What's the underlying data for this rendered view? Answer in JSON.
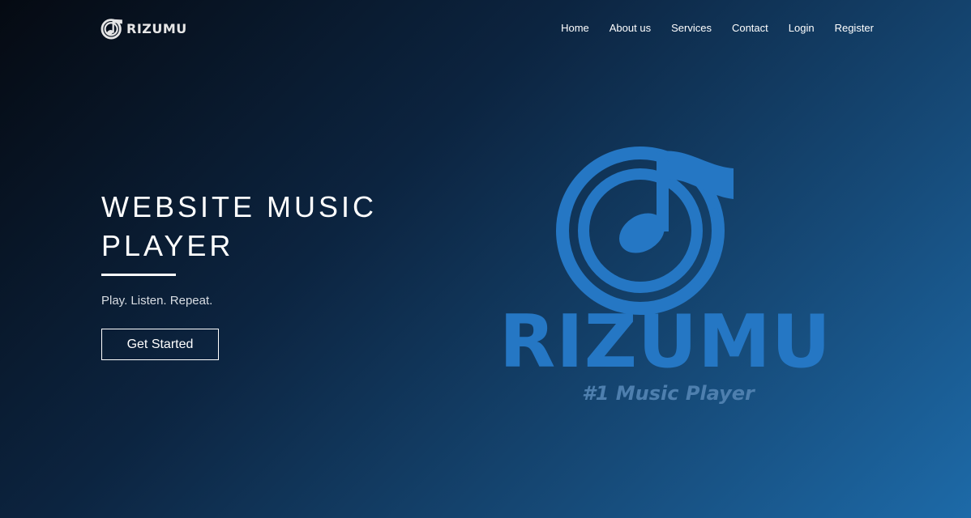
{
  "brand": {
    "name": "RIZUMU",
    "icon": "music-note-disc-icon"
  },
  "nav": {
    "items": [
      {
        "label": "Home"
      },
      {
        "label": "About us"
      },
      {
        "label": "Services"
      },
      {
        "label": "Contact"
      },
      {
        "label": "Login"
      },
      {
        "label": "Register"
      }
    ]
  },
  "hero": {
    "title_line1": "WEBSITE MUSIC",
    "title_line2": "PLAYER",
    "tagline": "Play. Listen. Repeat.",
    "cta_label": "Get Started"
  },
  "logo": {
    "wordmark": "RIZUMU",
    "slogan": "#1 Music Player",
    "icon": "music-note-disc-icon"
  },
  "colors": {
    "background_dark": "#050a12",
    "background_light": "#1d6aa8",
    "logo_blue": "#2577c4",
    "slogan_blue": "#4e7fae"
  }
}
